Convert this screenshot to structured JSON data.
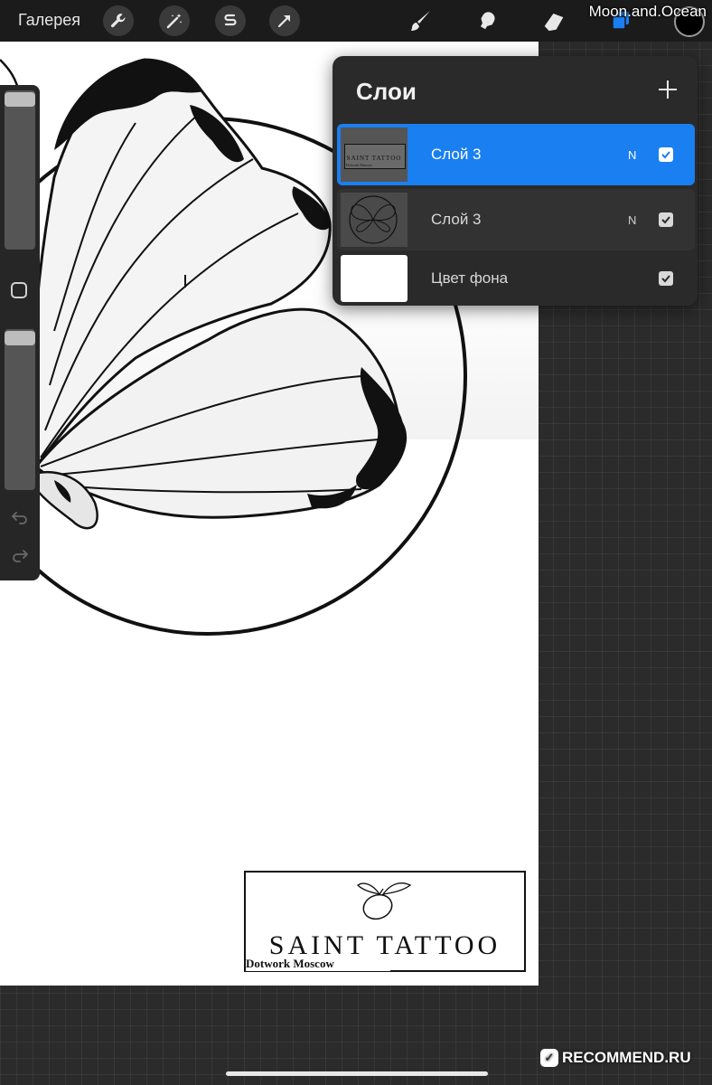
{
  "topbar": {
    "gallery_label": "Галерея",
    "tools": [
      {
        "icon": "wrench-icon"
      },
      {
        "icon": "magic-wand-icon"
      },
      {
        "icon": "selection-s-icon"
      },
      {
        "icon": "transform-arrow-icon"
      },
      {
        "icon": "brush-icon"
      },
      {
        "icon": "smudge-icon"
      },
      {
        "icon": "eraser-icon"
      },
      {
        "icon": "layers-icon"
      }
    ],
    "current_color": "#000000",
    "accent": "#1a7ff0"
  },
  "watermark_top": "Moon.and.Ocean",
  "layers_panel": {
    "title": "Слои",
    "add_icon": "plus-icon",
    "layers": [
      {
        "name": "Слой 3",
        "mode": "N",
        "visible": true,
        "selected": true,
        "thumb": "logo"
      },
      {
        "name": "Слой 3",
        "mode": "N",
        "visible": true,
        "selected": false,
        "thumb": "butterfly"
      },
      {
        "name": "Цвет фона",
        "mode": "",
        "visible": true,
        "selected": false,
        "thumb": "white"
      }
    ]
  },
  "canvas_logo": {
    "name": "SAINT TATTOO",
    "subtitle": "Dotwork Moscow"
  },
  "thumb_logo": {
    "name": "SAINT TATTOO",
    "subtitle": "Dotwork Moscow"
  },
  "watermark_bottom": "RECOMMEND.RU"
}
